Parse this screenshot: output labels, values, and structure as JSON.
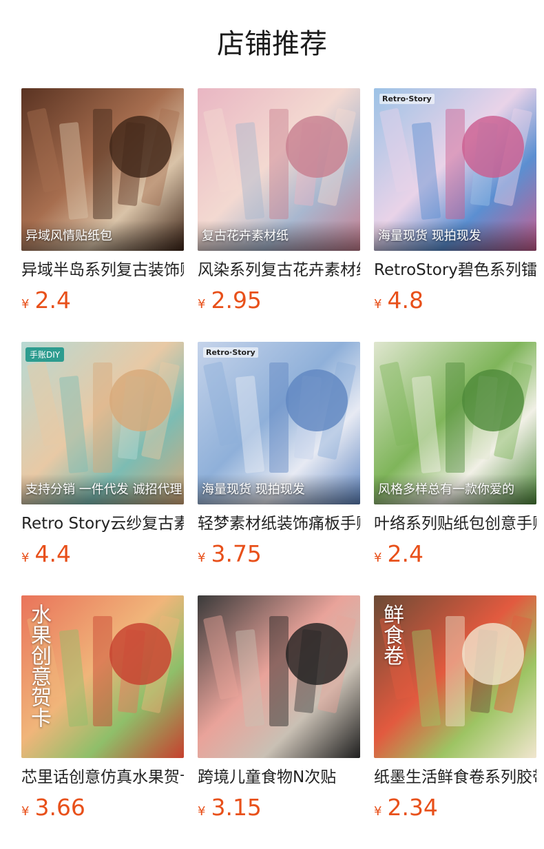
{
  "section_title": "店铺推荐",
  "currency_symbol": "¥",
  "price_color": "#e8501a",
  "products": [
    {
      "name": "异域半岛系列复古装饰贴纸包",
      "price": "2.4",
      "overlay": "异域风情贴纸包",
      "brand": "",
      "tag": "",
      "vertical": "",
      "colors": [
        "#5a3322",
        "#a76e4f",
        "#d9c3a8",
        "#3e2518"
      ]
    },
    {
      "name": "风染系列复古花卉素材纸",
      "price": "2.95",
      "overlay": "复古花卉素材纸",
      "brand": "",
      "tag": "",
      "vertical": "",
      "colors": [
        "#e9b6c3",
        "#f3d9d1",
        "#a8b7cf",
        "#c77e8f"
      ]
    },
    {
      "name": "RetroStory碧色系列镭射胶带",
      "price": "4.8",
      "overlay": "海量现货 现拍现发",
      "brand": "Retro·Story",
      "tag": "",
      "vertical": "",
      "colors": [
        "#9cc2e6",
        "#e9d3e8",
        "#5b8fd1",
        "#cb5d8e"
      ]
    },
    {
      "name": "Retro Story云纱复古素材纸",
      "price": "4.4",
      "overlay": "支持分销 一件代发 诚招代理",
      "brand": "",
      "tag": "手账DIY",
      "vertical": "",
      "colors": [
        "#b7d9d3",
        "#e8c9a5",
        "#7cbcb3",
        "#d7a979"
      ]
    },
    {
      "name": "轻梦素材纸装饰痛板手账",
      "price": "3.75",
      "overlay": "海量现货 现拍现发",
      "brand": "Retro·Story",
      "tag": "",
      "vertical": "",
      "colors": [
        "#c5d3ea",
        "#8fb0d9",
        "#e7eaf3",
        "#5f86c1"
      ]
    },
    {
      "name": "叶络系列贴纸包创意手账",
      "price": "2.4",
      "overlay": "风格多样总有一款你爱的",
      "brand": "",
      "tag": "",
      "vertical": "",
      "colors": [
        "#dfe6cf",
        "#7fb55a",
        "#f1f0e6",
        "#4e8a3a"
      ]
    },
    {
      "name": "芯里话创意仿真水果贺卡",
      "price": "3.66",
      "overlay": "",
      "brand": "",
      "tag": "",
      "vertical": "水果创意贺卡",
      "colors": [
        "#e9735a",
        "#f0b57a",
        "#8fbf6a",
        "#c6402e"
      ]
    },
    {
      "name": "跨境儿童食物N次贴",
      "price": "3.15",
      "overlay": "",
      "brand": "",
      "tag": "",
      "vertical": "",
      "colors": [
        "#3a3a3a",
        "#e9a39a",
        "#c9c0b4",
        "#1f1f1f"
      ]
    },
    {
      "name": "纸墨生活鲜食卷系列胶带",
      "price": "2.34",
      "overlay": "",
      "brand": "",
      "tag": "",
      "vertical": "鲜食卷",
      "colors": [
        "#6b4a35",
        "#e25a3f",
        "#9dc463",
        "#f1e6cf"
      ]
    }
  ]
}
